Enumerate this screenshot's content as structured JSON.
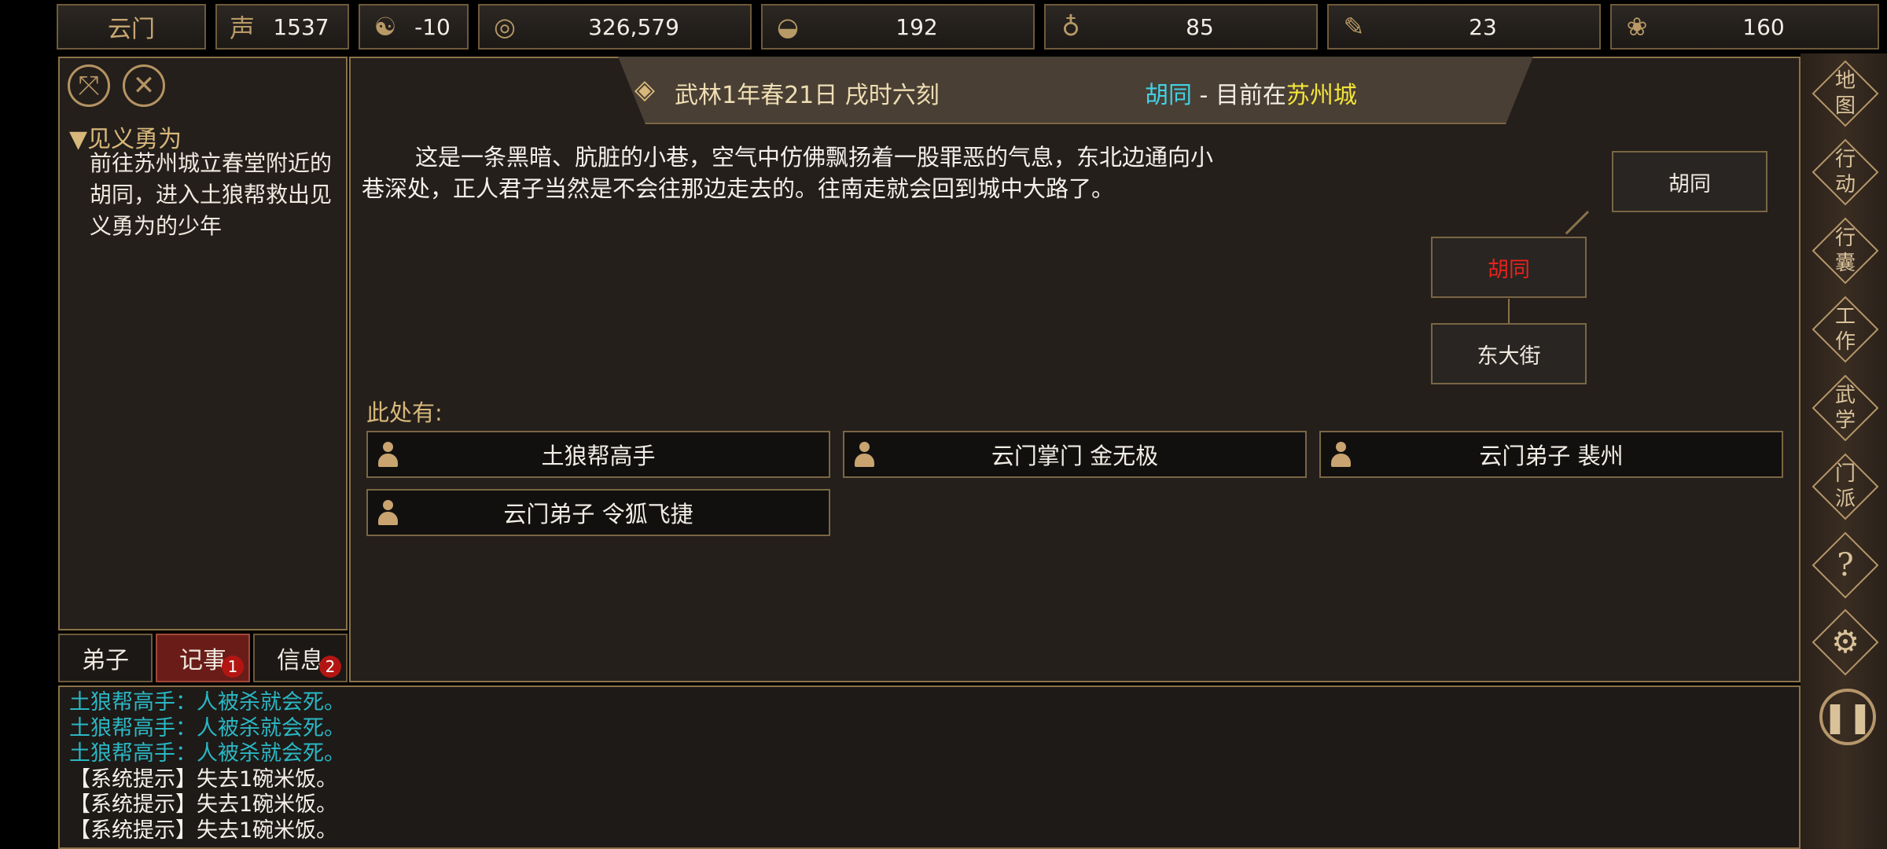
{
  "topbar": {
    "sect": "云门",
    "stats": [
      {
        "icon": "reputation-icon",
        "glyph": "声",
        "value": "1537"
      },
      {
        "icon": "yinyang-icon",
        "glyph": "☯",
        "value": "-10"
      },
      {
        "icon": "coin-icon",
        "glyph": "◎",
        "value": "326,579"
      },
      {
        "icon": "food-bowl-icon",
        "glyph": "◒",
        "value": "192"
      },
      {
        "icon": "gourd-icon",
        "glyph": "♁",
        "value": "85"
      },
      {
        "icon": "scroll-icon",
        "glyph": "✎",
        "value": "23"
      },
      {
        "icon": "herb-icon",
        "glyph": "❀",
        "value": "160"
      }
    ]
  },
  "quest": {
    "title": "▼见义勇为",
    "body": "前往苏州城立春堂附近的胡同，进入土狼帮救出见义勇为的少年"
  },
  "tabs": [
    {
      "label": "弟子"
    },
    {
      "label": "记事",
      "badge": "1"
    },
    {
      "label": "信息",
      "badge": "2"
    }
  ],
  "header": {
    "date": "武林1年春21日 戌时六刻",
    "location_name": "胡同",
    "location_sep": " - 目前在",
    "city": "苏州城"
  },
  "description": "这是一条黑暗、肮脏的小巷，空气中仿佛飘扬着一股罪恶的气息，东北边通向小巷深处，正人君子当然是不会往那边走去的。往南走就会回到城中大路了。",
  "map": {
    "northeast": "胡同",
    "current": "胡同",
    "south": "东大街"
  },
  "here_label": "此处有:",
  "npcs": [
    {
      "name": "土狼帮高手"
    },
    {
      "name": "云门掌门 金无极"
    },
    {
      "name": "云门弟子 裴州"
    },
    {
      "name": "云门弟子 令狐飞捷"
    }
  ],
  "log": [
    {
      "text": "土狼帮高手：人被杀就会死。",
      "color": "#2ab7c4"
    },
    {
      "text": "土狼帮高手：人被杀就会死。",
      "color": "#2ab7c4"
    },
    {
      "text": "土狼帮高手：人被杀就会死。",
      "color": "#2ab7c4"
    },
    {
      "text": "【系统提示】失去1碗米饭。",
      "color": "#f5f1ea"
    },
    {
      "text": "【系统提示】失去1碗米饭。",
      "color": "#f5f1ea"
    },
    {
      "text": "【系统提示】失去1碗米饭。",
      "color": "#f5f1ea"
    }
  ],
  "menu": [
    {
      "label": "地图"
    },
    {
      "label": "行动"
    },
    {
      "label": "行囊"
    },
    {
      "label": "工作"
    },
    {
      "label": "武学"
    },
    {
      "label": "门派"
    },
    {
      "label": "?"
    }
  ],
  "colors": {
    "accent": "#d8b87a",
    "current_location": "#e8221c",
    "location_name": "#41d2e6",
    "city": "#f2e43a"
  }
}
